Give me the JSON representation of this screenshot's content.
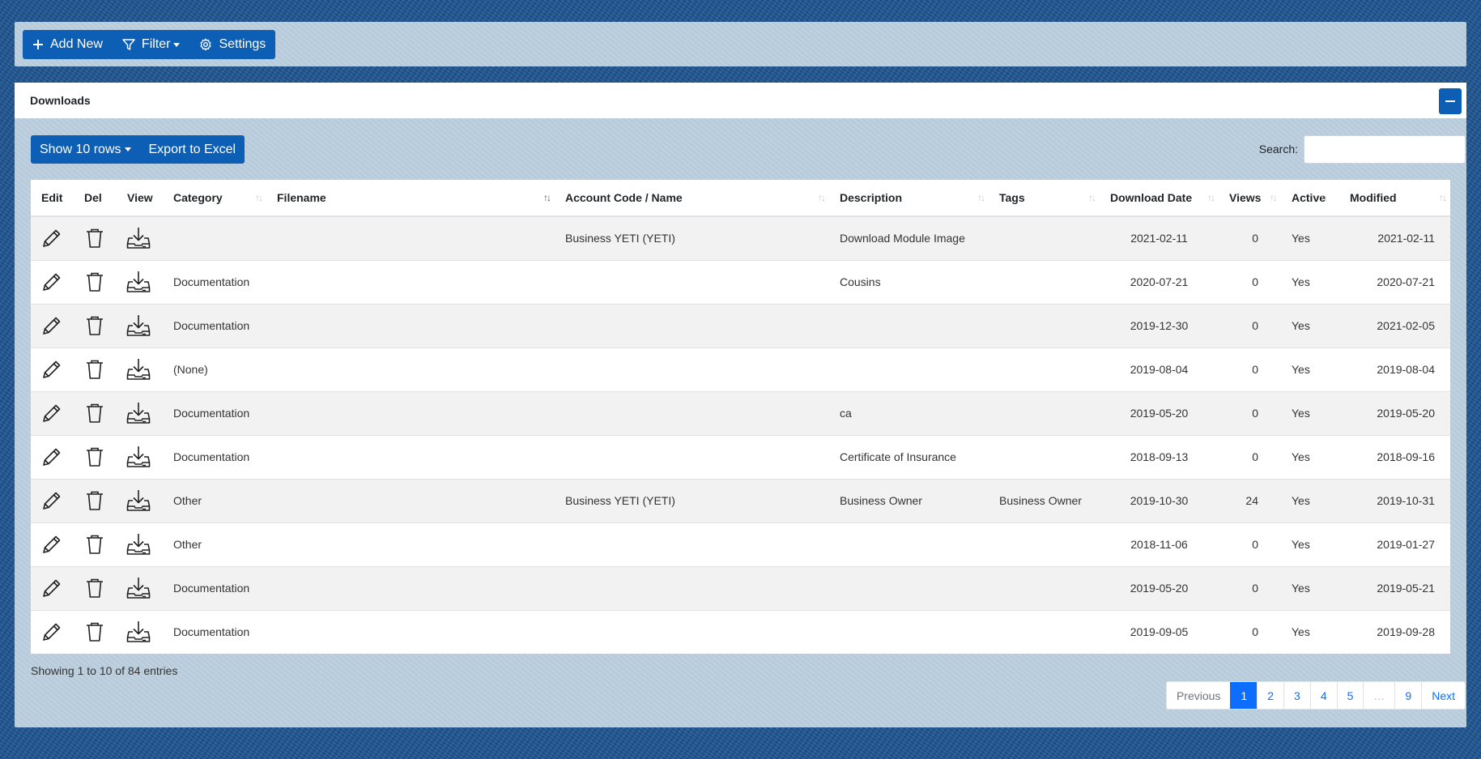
{
  "toolbar": {
    "add_new": "Add New",
    "filter": "Filter",
    "settings": "Settings"
  },
  "card": {
    "title": "Downloads",
    "show_rows": "Show 10 rows",
    "export": "Export to Excel",
    "search_label": "Search:",
    "search_value": ""
  },
  "table": {
    "headers": [
      "Edit",
      "Del",
      "View",
      "Category",
      "Filename",
      "Account Code / Name",
      "Description",
      "Tags",
      "Download Date",
      "Views",
      "Active",
      "Modified"
    ],
    "rows": [
      {
        "category": "",
        "filename": "",
        "account": "Business YETI (YETI)",
        "description": "Download Module Image",
        "tags": "",
        "download_date": "2021-02-11",
        "views": "0",
        "active": "Yes",
        "modified": "2021-02-11"
      },
      {
        "category": "Documentation",
        "filename": "",
        "account": "",
        "description": "Cousins",
        "tags": "",
        "download_date": "2020-07-21",
        "views": "0",
        "active": "Yes",
        "modified": "2020-07-21"
      },
      {
        "category": "Documentation",
        "filename": "",
        "account": "",
        "description": "",
        "tags": "",
        "download_date": "2019-12-30",
        "views": "0",
        "active": "Yes",
        "modified": "2021-02-05"
      },
      {
        "category": "(None)",
        "filename": "",
        "account": "",
        "description": "",
        "tags": "",
        "download_date": "2019-08-04",
        "views": "0",
        "active": "Yes",
        "modified": "2019-08-04"
      },
      {
        "category": "Documentation",
        "filename": "",
        "account": "",
        "description": "ca",
        "tags": "",
        "download_date": "2019-05-20",
        "views": "0",
        "active": "Yes",
        "modified": "2019-05-20"
      },
      {
        "category": "Documentation",
        "filename": "",
        "account": "",
        "description": "Certificate of Insurance",
        "tags": "",
        "download_date": "2018-09-13",
        "views": "0",
        "active": "Yes",
        "modified": "2018-09-16"
      },
      {
        "category": "Other",
        "filename": "",
        "account": "Business YETI (YETI)",
        "description": "Business Owner",
        "tags": "Business Owner",
        "download_date": "2019-10-30",
        "views": "24",
        "active": "Yes",
        "modified": "2019-10-31"
      },
      {
        "category": "Other",
        "filename": "",
        "account": "",
        "description": "",
        "tags": "",
        "download_date": "2018-11-06",
        "views": "0",
        "active": "Yes",
        "modified": "2019-01-27"
      },
      {
        "category": "Documentation",
        "filename": "",
        "account": "",
        "description": "",
        "tags": "",
        "download_date": "2019-05-20",
        "views": "0",
        "active": "Yes",
        "modified": "2019-05-21"
      },
      {
        "category": "Documentation",
        "filename": "",
        "account": "",
        "description": "",
        "tags": "",
        "download_date": "2019-09-05",
        "views": "0",
        "active": "Yes",
        "modified": "2019-09-28"
      }
    ]
  },
  "footer": {
    "info": "Showing 1 to 10 of 84 entries",
    "pages": [
      "Previous",
      "1",
      "2",
      "3",
      "4",
      "5",
      "…",
      "9",
      "Next"
    ],
    "active_page": "1"
  },
  "icons": {
    "edit": "pencil-icon",
    "delete": "trash-icon",
    "view": "download-icon"
  },
  "colors": {
    "primary": "#0d5fb6",
    "page_active": "#0d6efd",
    "background": "#1d5592"
  }
}
